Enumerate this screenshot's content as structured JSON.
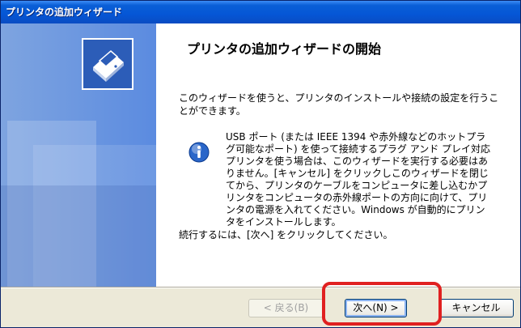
{
  "window": {
    "title": "プリンタの追加ウィザード"
  },
  "sidebar": {
    "icon": "printer-wizard-icon"
  },
  "content": {
    "heading": "プリンタの追加ウィザードの開始",
    "intro": "このウィザードを使うと、プリンタのインストールや接続の設定を行うことができます。",
    "info_icon": "info-icon",
    "info_text": "USB ポート (または IEEE 1394 や赤外線などのホットプラグ可能なポート) を使って接続するプラグ アンド プレイ対応プリンタを使う場合は、このウィザードを実行する必要はありません。[キャンセル] をクリックしこのウィザードを閉じてから、プリンタのケーブルをコンピュータに差し込むかプリンタをコンピュータの赤外線ポートの方向に向けて、プリンタの電源を入れてください。Windows が自動的にプリンタをインストールします。",
    "continue": "続行するには、[次へ] をクリックしてください。"
  },
  "buttons": {
    "back": "< 戻る(B)",
    "next": "次へ(N) >",
    "cancel": "キャンセル"
  },
  "annotation": {
    "highlight_color": "#e02020"
  }
}
